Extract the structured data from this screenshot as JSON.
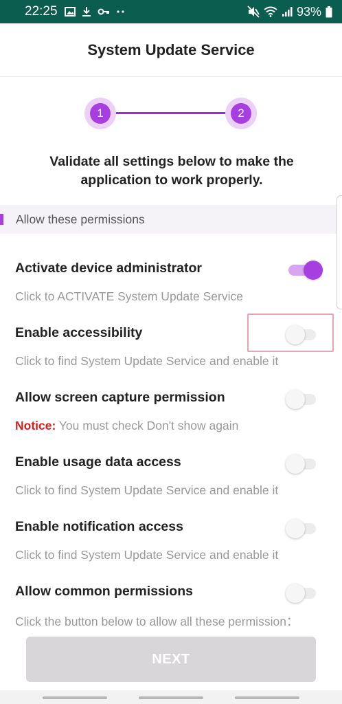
{
  "status_bar": {
    "time": "22:25",
    "left_icons": [
      "gallery-icon",
      "download-icon",
      "key-icon",
      "more-dots-icon"
    ],
    "right_icons": [
      "mute-icon",
      "wifi-icon",
      "signal-icon",
      "battery-icon"
    ],
    "battery": "93%"
  },
  "app_bar": {
    "title": "System Update Service"
  },
  "stepper": {
    "steps": [
      "1",
      "2"
    ],
    "current": 2
  },
  "instructions": "Validate all settings below to make the application to work properly.",
  "section": {
    "label": "Allow these permissions"
  },
  "permissions": [
    {
      "title": "Activate device administrator",
      "description": "Click to ACTIVATE System Update Service",
      "enabled": true
    },
    {
      "title": "Enable accessibility",
      "description": "Click to find System Update Service and enable it",
      "enabled": false
    },
    {
      "title": "Allow screen capture permission",
      "notice_label": "Notice:",
      "description": " You must check Don't show again",
      "enabled": false
    },
    {
      "title": "Enable usage data access",
      "description": "Click to find System Update Service and enable it",
      "enabled": false
    },
    {
      "title": "Enable notification access",
      "description": "Click to find System Update Service and enable it",
      "enabled": false
    },
    {
      "title": "Allow common permissions",
      "description": "Click the button below to allow all these permission：",
      "enabled": false
    }
  ],
  "next_button": {
    "label": "NEXT"
  },
  "colors": {
    "status_bar": "#0b5e4f",
    "accent": "#a63ee0",
    "notice": "#d81b1b",
    "button_disabled": "#d9d6da"
  }
}
